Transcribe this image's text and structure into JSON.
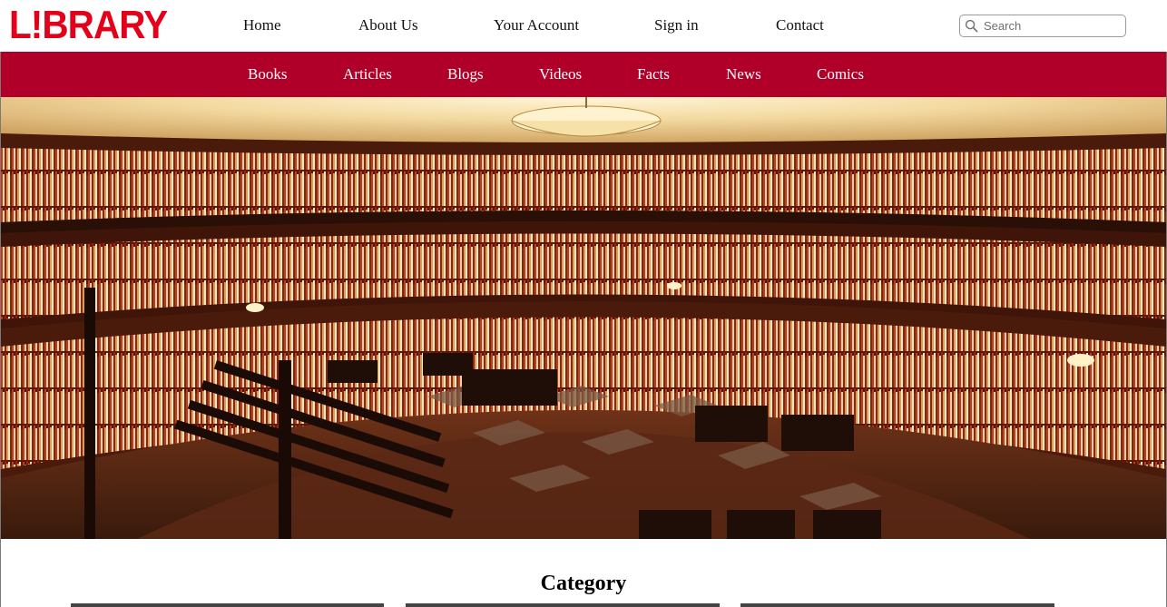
{
  "brand": {
    "logo_text": "L!BRARY",
    "logo_color": "#e3001b"
  },
  "top_nav": [
    {
      "label": "Home"
    },
    {
      "label": "About Us"
    },
    {
      "label": "Your Account"
    },
    {
      "label": "Sign in"
    },
    {
      "label": "Contact"
    }
  ],
  "search": {
    "placeholder": "Search",
    "value": ""
  },
  "category_nav": {
    "background": "#b0002a",
    "items": [
      {
        "label": "Books"
      },
      {
        "label": "Articles"
      },
      {
        "label": "Blogs"
      },
      {
        "label": "Videos"
      },
      {
        "label": "Facts"
      },
      {
        "label": "News"
      },
      {
        "label": "Comics"
      }
    ]
  },
  "hero": {
    "icon": "library-interior-photo"
  },
  "category_section": {
    "title": "Category"
  }
}
